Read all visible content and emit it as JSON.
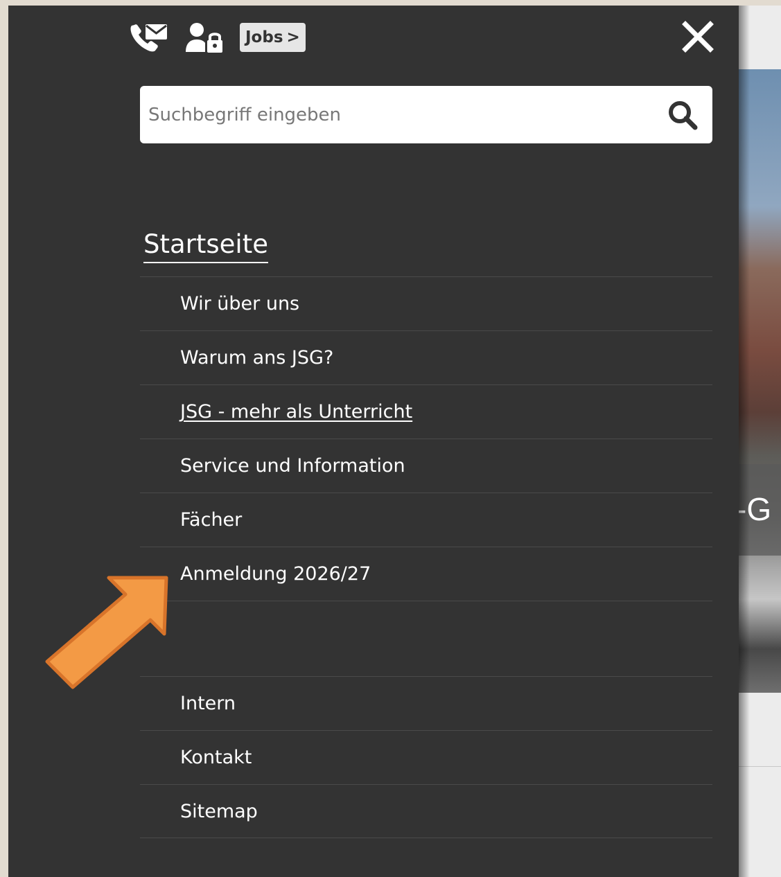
{
  "header": {
    "jobs_label": "Jobs",
    "jobs_chevron": ">"
  },
  "search": {
    "placeholder": "Suchbegriff eingeben",
    "value": ""
  },
  "nav": {
    "home": "Startseite",
    "items": [
      "Wir über uns",
      "Warum ans JSG?",
      "JSG - mehr als Unterricht",
      "Service und Information",
      "Fächer",
      "Anmeldung 2026/27",
      "Intern",
      "Kontakt",
      "Sitemap"
    ]
  },
  "background": {
    "fragment_text": "-G"
  },
  "icons": {
    "contact": "phone-mail-icon",
    "login": "user-lock-icon",
    "close": "close-icon",
    "search": "search-icon",
    "annotation": "orange-arrow-annotation"
  },
  "colors": {
    "panel": "#333333",
    "surround": "#e2dbd0",
    "text": "#ffffff",
    "arrow": "#f39a45",
    "arrow_outline": "#d8742a"
  }
}
